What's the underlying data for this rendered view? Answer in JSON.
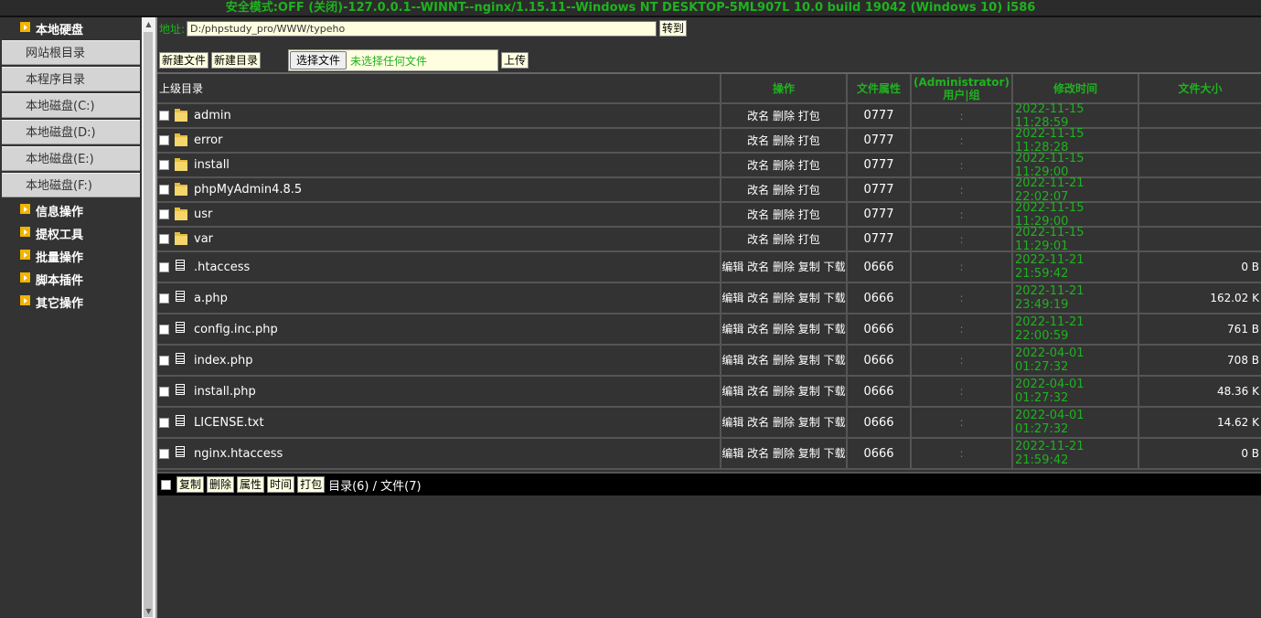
{
  "topbar": "安全模式:OFF (关闭)-127.0.0.1--WINNT--nginx/1.15.11--Windows NT DESKTOP-5ML907L 10.0 build 19042 (Windows 10) i586",
  "sidebar": {
    "local_disk": "本地硬盘",
    "items": [
      "网站根目录",
      "本程序目录",
      "本地磁盘(C:)",
      "本地磁盘(D:)",
      "本地磁盘(E:)",
      "本地磁盘(F:)"
    ],
    "groups": [
      "信息操作",
      "提权工具",
      "批量操作",
      "脚本插件",
      "其它操作"
    ]
  },
  "address": {
    "label": "地址:",
    "value": "D:/phpstudy_pro/WWW/typeho",
    "goto": "转到"
  },
  "tools": {
    "new_file": "新建文件",
    "new_dir": "新建目录",
    "choose_file": "选择文件",
    "no_file": "未选择任何文件",
    "upload": "上传"
  },
  "table": {
    "headers": {
      "parent": "上级目录",
      "ops": "操作",
      "perm": "文件属性",
      "owner_line1": "(Administrator)",
      "owner_line2": "用户|组",
      "time": "修改时间",
      "size": "文件大小"
    },
    "dir_ops": "改名 删除 打包",
    "file_ops": "编辑 改名 删除 复制 下载",
    "owner": ":",
    "dirs": [
      {
        "name": "admin",
        "perm": "0777",
        "time": "2022-11-15 11:28:59"
      },
      {
        "name": "error",
        "perm": "0777",
        "time": "2022-11-15 11:28:28"
      },
      {
        "name": "install",
        "perm": "0777",
        "time": "2022-11-15 11:29:00"
      },
      {
        "name": "phpMyAdmin4.8.5",
        "perm": "0777",
        "time": "2022-11-21 22:02:07"
      },
      {
        "name": "usr",
        "perm": "0777",
        "time": "2022-11-15 11:29:00"
      },
      {
        "name": "var",
        "perm": "0777",
        "time": "2022-11-15 11:29:01"
      }
    ],
    "files": [
      {
        "name": ".htaccess",
        "perm": "0666",
        "time": "2022-11-21 21:59:42",
        "size": "0 B"
      },
      {
        "name": "a.php",
        "perm": "0666",
        "time": "2022-11-21 23:49:19",
        "size": "162.02 K"
      },
      {
        "name": "config.inc.php",
        "perm": "0666",
        "time": "2022-11-21 22:00:59",
        "size": "761 B"
      },
      {
        "name": "index.php",
        "perm": "0666",
        "time": "2022-04-01 01:27:32",
        "size": "708 B"
      },
      {
        "name": "install.php",
        "perm": "0666",
        "time": "2022-04-01 01:27:32",
        "size": "48.36 K"
      },
      {
        "name": "LICENSE.txt",
        "perm": "0666",
        "time": "2022-04-01 01:27:32",
        "size": "14.62 K"
      },
      {
        "name": "nginx.htaccess",
        "perm": "0666",
        "time": "2022-11-21 21:59:42",
        "size": "0 B"
      }
    ]
  },
  "bottom": {
    "buttons": [
      "复制",
      "删除",
      "属性",
      "时间",
      "打包"
    ],
    "summary": "目录(6) / 文件(7)"
  }
}
